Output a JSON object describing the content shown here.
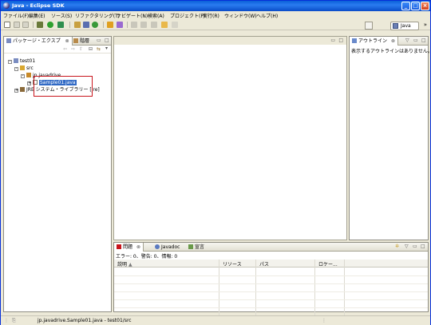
{
  "window": {
    "title": "Java - Eclipse SDK"
  },
  "menu": [
    "ファイル(F)",
    "編集(E)",
    "ソース(S)",
    "リファクタリング(T)",
    "ナビゲート(N)",
    "検索(A)",
    "プロジェクト(P)",
    "実行(R)",
    "ウィンドウ(W)",
    "ヘルプ(H)"
  ],
  "perspective": {
    "label": "Java"
  },
  "left_panel": {
    "tabs": [
      "パッケージ・エクスプ",
      "階層"
    ],
    "tree": {
      "project": "test01",
      "src": "src",
      "package": "jp.javadrive",
      "file": "Sample01.java",
      "library": "JRE システム・ライブラリー [jre]"
    }
  },
  "outline": {
    "tab": "アウトライン",
    "message": "表示するアウトラインはありません。"
  },
  "problems": {
    "tabs": [
      "問題",
      "Javadoc",
      "宣言"
    ],
    "summary": "エラー: 0、警告: 0、情報: 0",
    "columns": [
      "説明",
      "リソース",
      "パス",
      "ロケー..."
    ]
  },
  "status": {
    "text": "jp.javadrive.Sample01.java - test01/src"
  },
  "colors": {
    "accent": "#316ac5",
    "highlight_box": "#c8141c",
    "titlebar": "#0a5fd8"
  }
}
